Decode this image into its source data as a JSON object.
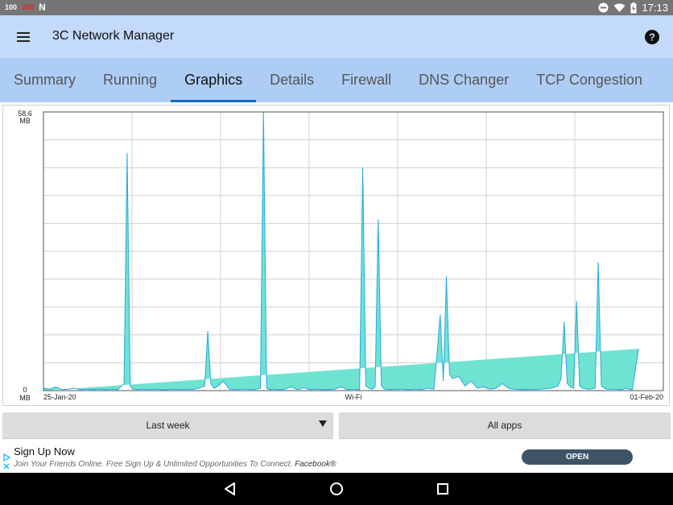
{
  "status_bar": {
    "left_indicator_1": "100",
    "left_indicator_2": "338",
    "left_indicator_3": "N",
    "time": "17:13"
  },
  "app_bar": {
    "title": "3C Network Manager"
  },
  "tabs": [
    {
      "label": "Summary",
      "active": false
    },
    {
      "label": "Running",
      "active": false
    },
    {
      "label": "Graphics",
      "active": true
    },
    {
      "label": "Details",
      "active": false
    },
    {
      "label": "Firewall",
      "active": false
    },
    {
      "label": "DNS Changer",
      "active": false
    },
    {
      "label": "TCP Congestion",
      "active": false
    }
  ],
  "chart": {
    "y_top_label_line1": "58.6",
    "y_top_label_line2": "MB",
    "y_bottom_label_line1": "0",
    "y_bottom_label_line2": "MB",
    "x_start_label": "25-Jan-20",
    "x_center_label": "Wi-Fi",
    "x_end_label": "01-Feb-20",
    "fill_color": "#6fe3d2",
    "line_color": "#27a8e0"
  },
  "chart_data": {
    "type": "area",
    "xlabel": "Wi-Fi",
    "ylabel": "",
    "ylim": [
      0,
      58.6
    ],
    "x_range": [
      "25-Jan-20",
      "01-Feb-20"
    ],
    "x": [
      0.0,
      0.01,
      0.02,
      0.03,
      0.04,
      0.05,
      0.06,
      0.07,
      0.08,
      0.09,
      0.1,
      0.11,
      0.12,
      0.13,
      0.135,
      0.14,
      0.145,
      0.15,
      0.16,
      0.17,
      0.18,
      0.19,
      0.2,
      0.21,
      0.22,
      0.23,
      0.24,
      0.25,
      0.26,
      0.265,
      0.27,
      0.275,
      0.28,
      0.29,
      0.3,
      0.31,
      0.32,
      0.33,
      0.34,
      0.35,
      0.355,
      0.36,
      0.365,
      0.37,
      0.38,
      0.39,
      0.4,
      0.41,
      0.42,
      0.43,
      0.44,
      0.45,
      0.46,
      0.47,
      0.48,
      0.49,
      0.5,
      0.51,
      0.515,
      0.52,
      0.525,
      0.53,
      0.535,
      0.54,
      0.545,
      0.55,
      0.56,
      0.57,
      0.58,
      0.59,
      0.6,
      0.61,
      0.62,
      0.63,
      0.635,
      0.64,
      0.645,
      0.65,
      0.655,
      0.66,
      0.67,
      0.68,
      0.69,
      0.7,
      0.71,
      0.72,
      0.73,
      0.74,
      0.75,
      0.76,
      0.78,
      0.8,
      0.82,
      0.83,
      0.835,
      0.84,
      0.845,
      0.85,
      0.855,
      0.86,
      0.865,
      0.87,
      0.88,
      0.89,
      0.895,
      0.9,
      0.905,
      0.91,
      0.92,
      0.93,
      0.935,
      0.94,
      0.945,
      0.95,
      0.96,
      0.97,
      0.98,
      0.99,
      1.0
    ],
    "values": [
      0.5,
      0.3,
      0.8,
      0.2,
      0.3,
      0.5,
      0.2,
      0.3,
      0.2,
      0.3,
      0.2,
      0.3,
      0.2,
      1.5,
      50.0,
      1.0,
      0.3,
      0.2,
      0.3,
      0.2,
      0.3,
      0.2,
      0.2,
      0.3,
      0.2,
      0.3,
      0.2,
      0.5,
      1.0,
      12.5,
      1.5,
      0.5,
      0.8,
      2.0,
      0.3,
      0.2,
      0.3,
      0.3,
      0.2,
      0.5,
      58.6,
      0.5,
      0.2,
      0.3,
      0.2,
      0.3,
      0.8,
      0.2,
      0.6,
      0.2,
      0.3,
      0.2,
      0.2,
      0.3,
      0.8,
      0.2,
      0.3,
      0.2,
      47.0,
      1.0,
      0.5,
      0.3,
      0.8,
      36.0,
      1.0,
      0.3,
      0.2,
      0.3,
      0.3,
      0.2,
      0.3,
      0.2,
      0.5,
      0.3,
      8.0,
      16.0,
      2.0,
      24.0,
      3.5,
      2.5,
      3.0,
      1.0,
      2.0,
      0.5,
      0.8,
      0.3,
      0.5,
      1.5,
      0.5,
      0.3,
      0.2,
      0.3,
      0.5,
      1.0,
      2.5,
      14.5,
      1.5,
      0.8,
      0.5,
      18.8,
      1.0,
      0.5,
      0.3,
      0.5,
      27.0,
      1.0,
      0.5,
      0.3,
      0.3,
      0.2,
      0.3,
      0.5,
      0.3,
      0.2,
      8.8
    ]
  },
  "controls": {
    "period_label": "Last week",
    "apps_label": "All apps"
  },
  "ad": {
    "title": "Sign Up Now",
    "description": "Join Your Friends Online. Free Sign Up & Unlimited Opportunities To Connect.",
    "advertiser": "Facebook®",
    "cta": "OPEN"
  }
}
